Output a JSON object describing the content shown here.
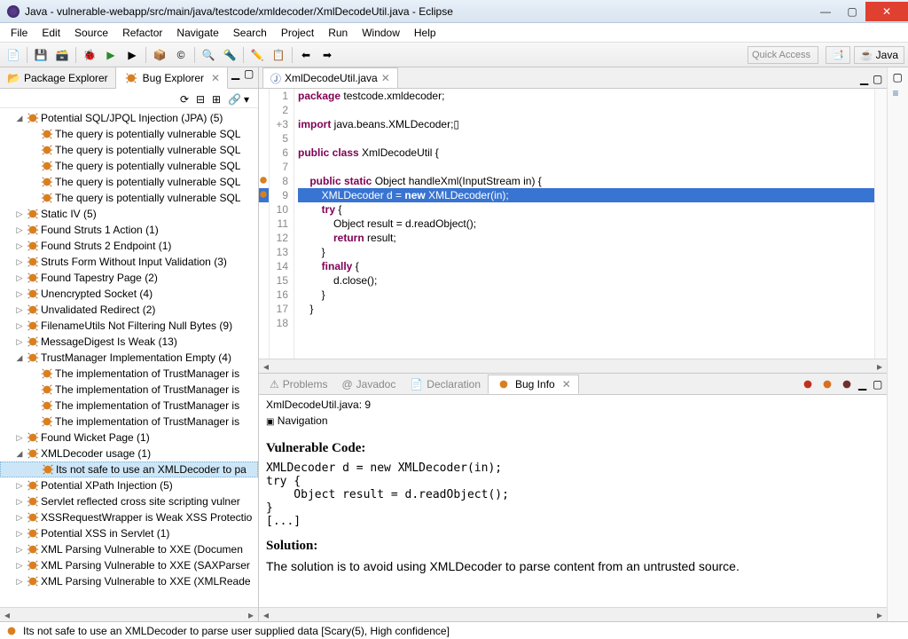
{
  "window": {
    "title": "Java - vulnerable-webapp/src/main/java/testcode/xmldecoder/XmlDecodeUtil.java - Eclipse"
  },
  "menubar": [
    "File",
    "Edit",
    "Source",
    "Refactor",
    "Navigate",
    "Search",
    "Project",
    "Run",
    "Window",
    "Help"
  ],
  "quick_access": "Quick Access",
  "perspective": {
    "java": "Java"
  },
  "left": {
    "tabs": {
      "package_explorer": "Package Explorer",
      "bug_explorer": "Bug Explorer"
    },
    "tree": [
      {
        "lvl": 0,
        "exp": "open",
        "label": "Potential SQL/JPQL Injection (JPA) (5)"
      },
      {
        "lvl": 1,
        "label": "The query is potentially vulnerable SQL"
      },
      {
        "lvl": 1,
        "label": "The query is potentially vulnerable SQL"
      },
      {
        "lvl": 1,
        "label": "The query is potentially vulnerable SQL"
      },
      {
        "lvl": 1,
        "label": "The query is potentially vulnerable SQL"
      },
      {
        "lvl": 1,
        "label": "The query is potentially vulnerable SQL"
      },
      {
        "lvl": 0,
        "exp": "closed",
        "label": "Static IV (5)"
      },
      {
        "lvl": 0,
        "exp": "closed",
        "label": "Found Struts 1 Action (1)"
      },
      {
        "lvl": 0,
        "exp": "closed",
        "label": "Found Struts 2 Endpoint (1)"
      },
      {
        "lvl": 0,
        "exp": "closed",
        "label": "Struts Form Without Input Validation (3)"
      },
      {
        "lvl": 0,
        "exp": "closed",
        "label": "Found Tapestry Page (2)"
      },
      {
        "lvl": 0,
        "exp": "closed",
        "label": "Unencrypted Socket (4)"
      },
      {
        "lvl": 0,
        "exp": "closed",
        "label": "Unvalidated Redirect (2)"
      },
      {
        "lvl": 0,
        "exp": "closed",
        "label": "FilenameUtils Not Filtering Null Bytes (9)"
      },
      {
        "lvl": 0,
        "exp": "closed",
        "label": "MessageDigest Is Weak (13)"
      },
      {
        "lvl": 0,
        "exp": "open",
        "label": "TrustManager Implementation Empty (4)"
      },
      {
        "lvl": 1,
        "label": "The implementation of TrustManager is"
      },
      {
        "lvl": 1,
        "label": "The implementation of TrustManager is"
      },
      {
        "lvl": 1,
        "label": "The implementation of TrustManager is"
      },
      {
        "lvl": 1,
        "label": "The implementation of TrustManager is"
      },
      {
        "lvl": 0,
        "exp": "closed",
        "label": "Found Wicket Page (1)"
      },
      {
        "lvl": 0,
        "exp": "open",
        "label": "XMLDecoder usage (1)"
      },
      {
        "lvl": 1,
        "selected": true,
        "label": "Its not safe to use an XMLDecoder to pa"
      },
      {
        "lvl": 0,
        "exp": "closed",
        "label": "Potential XPath Injection (5)"
      },
      {
        "lvl": 0,
        "exp": "closed",
        "label": "Servlet reflected cross site scripting vulner"
      },
      {
        "lvl": 0,
        "exp": "closed",
        "label": "XSSRequestWrapper is Weak XSS Protectio"
      },
      {
        "lvl": 0,
        "exp": "closed",
        "label": "Potential XSS in Servlet (1)"
      },
      {
        "lvl": 0,
        "exp": "closed",
        "label": "XML Parsing Vulnerable to XXE (Documen"
      },
      {
        "lvl": 0,
        "exp": "closed",
        "label": "XML Parsing Vulnerable to XXE (SAXParser"
      },
      {
        "lvl": 0,
        "exp": "closed",
        "label": "XML Parsing Vulnerable to XXE (XMLReade"
      }
    ]
  },
  "editor": {
    "tab_title": "XmlDecodeUtil.java",
    "lines": [
      {
        "n": 1,
        "html": "<span class='kw'>package</span> testcode.xmldecoder;"
      },
      {
        "n": 2,
        "html": ""
      },
      {
        "n": 3,
        "marker": "+",
        "html": "<span class='kw'>import</span> java.beans.XMLDecoder;▯"
      },
      {
        "n": 5,
        "html": ""
      },
      {
        "n": 6,
        "html": "<span class='kw'>public class</span> XmlDecodeUtil {"
      },
      {
        "n": 7,
        "html": ""
      },
      {
        "n": 8,
        "bug": true,
        "html": "    <span class='kw'>public static</span> Object handleXml(InputStream in) {"
      },
      {
        "n": 9,
        "hl": true,
        "bug": true,
        "html": "        XMLDecoder d = <span class='kw'>new</span> XMLDecoder(in);"
      },
      {
        "n": 10,
        "html": "        <span class='kw'>try</span> {"
      },
      {
        "n": 11,
        "html": "            Object result = d.readObject();"
      },
      {
        "n": 12,
        "html": "            <span class='kw'>return</span> result;"
      },
      {
        "n": 13,
        "html": "        }"
      },
      {
        "n": 14,
        "html": "        <span class='kw'>finally</span> {"
      },
      {
        "n": 15,
        "html": "            d.close();"
      },
      {
        "n": 16,
        "html": "        }"
      },
      {
        "n": 17,
        "html": "    }"
      },
      {
        "n": 18,
        "html": ""
      }
    ]
  },
  "bottom": {
    "tabs": {
      "problems": "Problems",
      "javadoc": "Javadoc",
      "declaration": "Declaration",
      "buginfo": "Bug Info"
    },
    "meta_line": "XmlDecodeUtil.java: 9",
    "nav": "Navigation",
    "heading1": "Vulnerable Code:",
    "code": "XMLDecoder d = new XMLDecoder(in);\ntry {\n    Object result = d.readObject();\n}\n[...]",
    "heading2": "Solution:",
    "solution": "The solution is to avoid using XMLDecoder to parse content from an untrusted source."
  },
  "statusbar": "Its not safe to use an XMLDecoder to parse user supplied data [Scary(5), High confidence]"
}
